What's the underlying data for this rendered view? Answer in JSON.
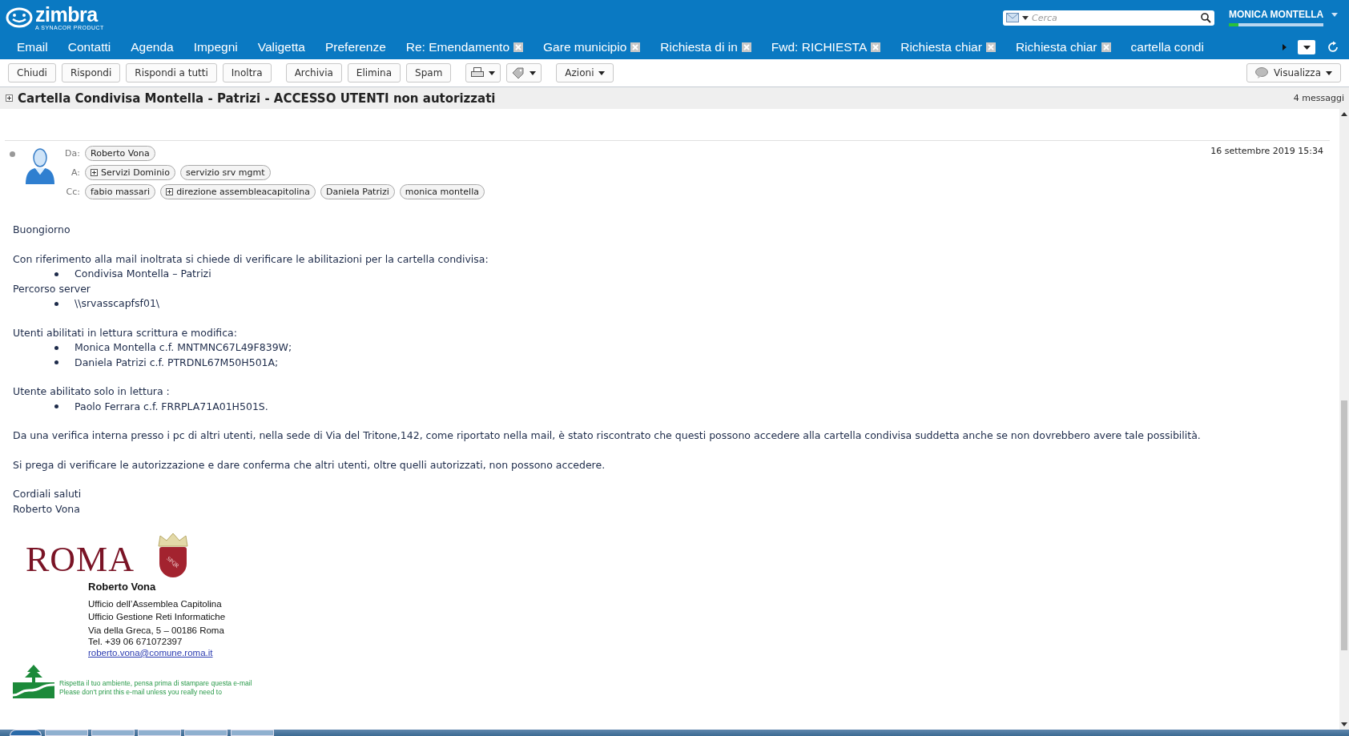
{
  "app": {
    "logo": "zimbra",
    "tagline": "A SYNACOR PRODUCT"
  },
  "search": {
    "placeholder": "Cerca"
  },
  "user": {
    "name": "MONICA MONTELLA",
    "quota": {
      "level": 0.1
    }
  },
  "tabs": [
    {
      "label": "Email",
      "kind": "app",
      "selected": false
    },
    {
      "label": "Contatti",
      "kind": "app",
      "selected": false
    },
    {
      "label": "Agenda",
      "kind": "app",
      "selected": false
    },
    {
      "label": "Impegni",
      "kind": "app",
      "selected": false
    },
    {
      "label": "Valigetta",
      "kind": "app",
      "selected": false
    },
    {
      "label": "Preferenze",
      "kind": "app",
      "selected": false
    },
    {
      "label": "Re: Emendamento",
      "kind": "doc",
      "selected": false
    },
    {
      "label": "Gare municipio",
      "kind": "doc",
      "selected": false
    },
    {
      "label": "Richiesta di in",
      "kind": "doc",
      "selected": false
    },
    {
      "label": "Fwd: RICHIESTA",
      "kind": "doc",
      "selected": false
    },
    {
      "label": "Richiesta chiar",
      "kind": "doc",
      "selected": false
    },
    {
      "label": "Richiesta chiar",
      "kind": "doc",
      "selected": false
    },
    {
      "label": "cartella condi",
      "kind": "app",
      "selected": false
    }
  ],
  "toolbar": [
    {
      "kind": "text",
      "label": "Chiudi"
    },
    {
      "kind": "text",
      "label": "Rispondi"
    },
    {
      "kind": "text",
      "label": "Rispondi a tutti"
    },
    {
      "kind": "text",
      "label": "Inoltra"
    },
    {
      "kind": "sep"
    },
    {
      "kind": "text",
      "label": "Archivia"
    },
    {
      "kind": "text",
      "label": "Elimina"
    },
    {
      "kind": "text",
      "label": "Spam"
    },
    {
      "kind": "sep"
    },
    {
      "kind": "print"
    },
    {
      "kind": "tag"
    },
    {
      "kind": "sep"
    },
    {
      "kind": "menu",
      "label": "Azioni"
    }
  ],
  "view_button": {
    "label": "Visualizza"
  },
  "subject": "Cartella Condivisa Montella - Patrizi - ACCESSO UTENTI non autorizzati",
  "message_count": "4 messaggi",
  "message": {
    "date": "16 settembre 2019 15:34",
    "rows": [
      {
        "label": "Da:",
        "people": [
          {
            "name": "Roberto Vona",
            "group": false
          }
        ]
      },
      {
        "label": "A:",
        "people": [
          {
            "name": "Servizi Dominio",
            "group": true
          },
          {
            "name": "servizio srv mgmt",
            "group": false
          }
        ]
      },
      {
        "label": "Cc:",
        "people": [
          {
            "name": "fabio massari",
            "group": false
          },
          {
            "name": "direzione assembleacapitolina",
            "group": true
          },
          {
            "name": "Daniela Patrizi",
            "group": false
          },
          {
            "name": "monica montella",
            "group": false
          }
        ]
      }
    ]
  },
  "body": [
    {
      "kind": "p",
      "text": "Buongiorno"
    },
    {
      "kind": "gap"
    },
    {
      "kind": "p",
      "text": "Con riferimento alla mail inoltrata si chiede di verificare le abilitazioni per la cartella condivisa:"
    },
    {
      "kind": "list",
      "items": [
        "Condivisa Montella – Patrizi"
      ]
    },
    {
      "kind": "p",
      "text": "Percorso server"
    },
    {
      "kind": "list",
      "items": [
        "\\\\srvasscapfsf01\\"
      ]
    },
    {
      "kind": "gap"
    },
    {
      "kind": "p",
      "text": "Utenti abilitati in lettura scrittura e modifica:"
    },
    {
      "kind": "list",
      "items": [
        "Monica Montella c.f. MNTMNC67L49F839W;",
        "Daniela Patrizi c.f. PTRDNL67M50H501A;"
      ]
    },
    {
      "kind": "gap"
    },
    {
      "kind": "p",
      "text": "Utente abilitato solo in lettura :"
    },
    {
      "kind": "list",
      "items": [
        "Paolo Ferrara c.f. FRRPLA71A01H501S."
      ]
    },
    {
      "kind": "gap"
    },
    {
      "kind": "p",
      "text": "Da una verifica interna presso i pc di altri utenti, nella sede di Via del Tritone,142, come riportato nella mail,  è stato riscontrato che questi possono accedere alla cartella condivisa suddetta anche se non dovrebbero avere tale possibilità."
    },
    {
      "kind": "gap"
    },
    {
      "kind": "p",
      "text": "Si prega di verificare le autorizzazione e dare conferma che altri utenti, oltre quelli autorizzati, non possono accedere."
    },
    {
      "kind": "gap"
    },
    {
      "kind": "p",
      "text": "Cordiali saluti"
    },
    {
      "kind": "p",
      "text": "Roberto Vona"
    }
  ],
  "signature": {
    "logo_text": "ROMA",
    "crest_text": "SPQR",
    "name": "Roberto Vona",
    "lines": [
      "Ufficio dell’Assemblea Capitolina",
      "Ufficio Gestione Reti Informatiche"
    ],
    "address": [
      "Via della Greca, 5 – 00186 Roma",
      "Tel. +39 06 671072397"
    ],
    "email": "roberto.vona@comune.roma.it",
    "eco": [
      "Rispetta il tuo ambiente, pensa prima di stampare questa e-mail",
      "Please don't print this e-mail unless you really need to"
    ]
  }
}
